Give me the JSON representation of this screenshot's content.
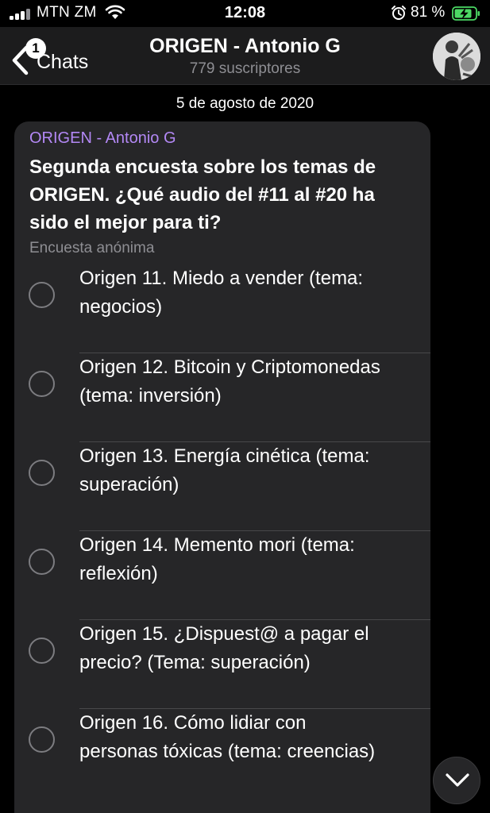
{
  "status_bar": {
    "carrier": "MTN ZM",
    "time": "12:08",
    "battery_percent": "81 %",
    "icons": [
      "signal-icon",
      "wifi-icon",
      "alarm-icon",
      "battery-charging-icon"
    ]
  },
  "header": {
    "back_label": "Chats",
    "unread_badge": "1",
    "title": "ORIGEN - Antonio G",
    "subtitle": "779 suscriptores",
    "avatar_icon": "channel-avatar"
  },
  "chat": {
    "date": "5 de agosto de 2020",
    "poll": {
      "author": "ORIGEN - Antonio G",
      "question": "Segunda encuesta sobre los temas de ORIGEN. ¿Qué audio del #11 al #20 ha sido el mejor para ti?",
      "type": "Encuesta anónima",
      "options": [
        {
          "label": "Origen 11. Miedo a vender (tema: negocios)"
        },
        {
          "label": "Origen 12. Bitcoin y Criptomonedas (tema: inversión)"
        },
        {
          "label": "Origen 13. Energía cinética (tema: superación)"
        },
        {
          "label": "Origen 14. Memento mori (tema: reflexión)"
        },
        {
          "label": "Origen 15. ¿Dispuest@ a pagar el precio? (Tema: superación)"
        },
        {
          "label": "Origen 16. Cómo lidiar con personas tóxicas (tema: creencias)"
        }
      ]
    }
  },
  "colors": {
    "background": "#000000",
    "bubble": "#262628",
    "author": "#b388f5",
    "secondary_text": "#8e8e93",
    "battery_green": "#4cd964"
  }
}
